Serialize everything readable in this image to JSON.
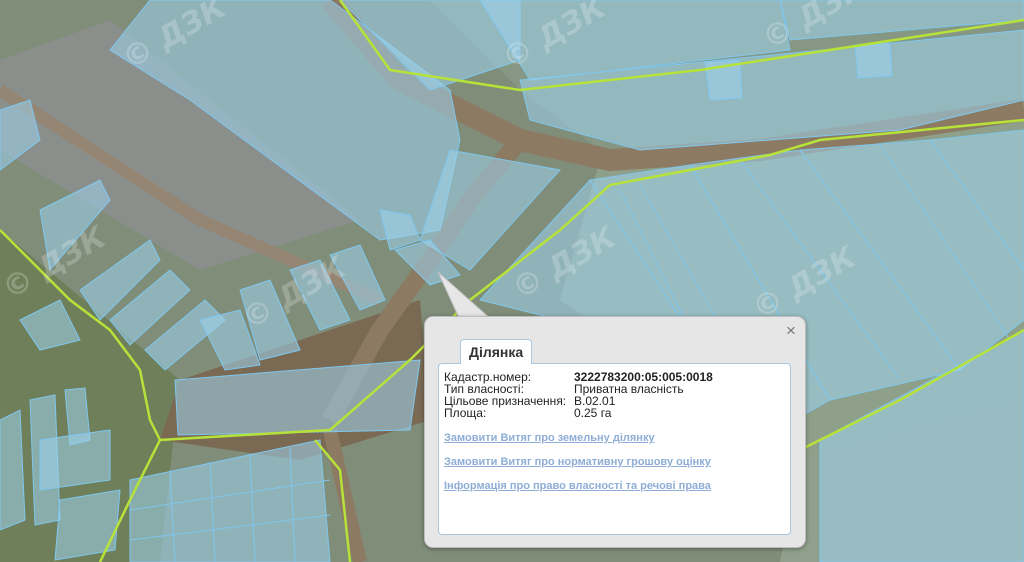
{
  "map": {
    "watermark": "© ДЗК",
    "colors": {
      "parcel_fill": "#9fd4ee",
      "parcel_stroke": "#7fc7ee",
      "boundary": "#b7e23a",
      "field": "#8a9a82",
      "road": "#8f7d66"
    }
  },
  "popup": {
    "close_icon": "×",
    "tab_label": "Ділянка",
    "fields": [
      {
        "label": "Кадастр.номер:",
        "value": "3222783200:05:005:0018"
      },
      {
        "label": "Тип власності:",
        "value": "Приватна власність"
      },
      {
        "label": "Цільове призначення:",
        "value": "В.02.01"
      },
      {
        "label": "Площа:",
        "value": "0.25 га"
      }
    ],
    "links": [
      "Замовити Витяг про земельну ділянку",
      "Замовити Витяг про нормативну грошову оцінку",
      "Інформація про право власності та речові права"
    ]
  }
}
